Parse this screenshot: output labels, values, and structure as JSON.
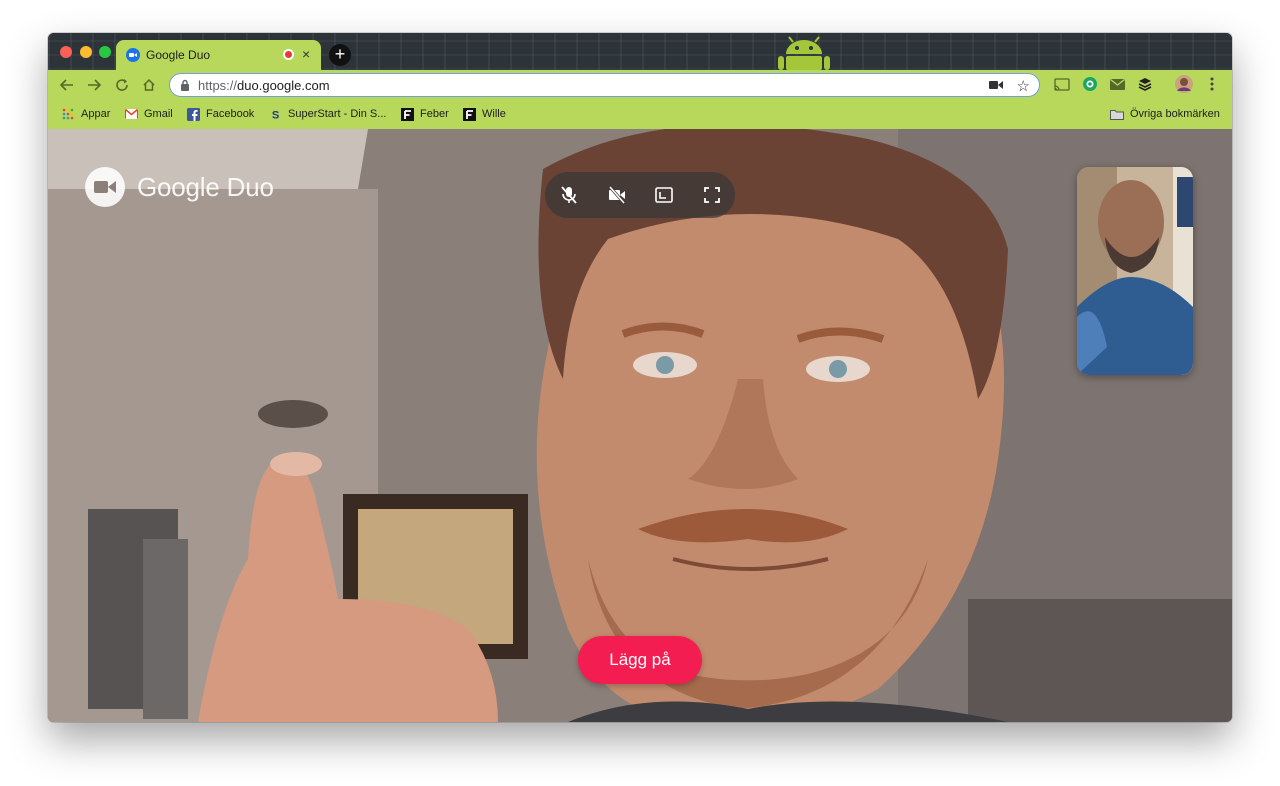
{
  "browser": {
    "tab": {
      "title": "Google Duo",
      "close_glyph": "×",
      "favicon": "duo-favicon"
    },
    "new_tab_glyph": "+",
    "address": {
      "scheme": "https://",
      "host": "duo.google.com"
    },
    "bookmarks": [
      {
        "label": "Appar",
        "icon": "apps-grid-icon"
      },
      {
        "label": "Gmail",
        "icon": "gmail-icon"
      },
      {
        "label": "Facebook",
        "icon": "facebook-icon"
      },
      {
        "label": "SuperStart - Din S...",
        "icon": "superstart-icon"
      },
      {
        "label": "Feber",
        "icon": "feber-icon"
      },
      {
        "label": "Wille",
        "icon": "wille-icon"
      }
    ],
    "other_bookmarks": "Övriga bokmärken",
    "theme_colors": {
      "frame": "#b7d85b",
      "tabstrip": "#2c343a"
    }
  },
  "duo": {
    "logo_text": "Google Duo",
    "controls": [
      "mute-mic-icon",
      "camera-off-icon",
      "picture-in-picture-icon",
      "fullscreen-icon"
    ],
    "hangup_label": "Lägg på",
    "hangup_color": "#f31d52"
  }
}
